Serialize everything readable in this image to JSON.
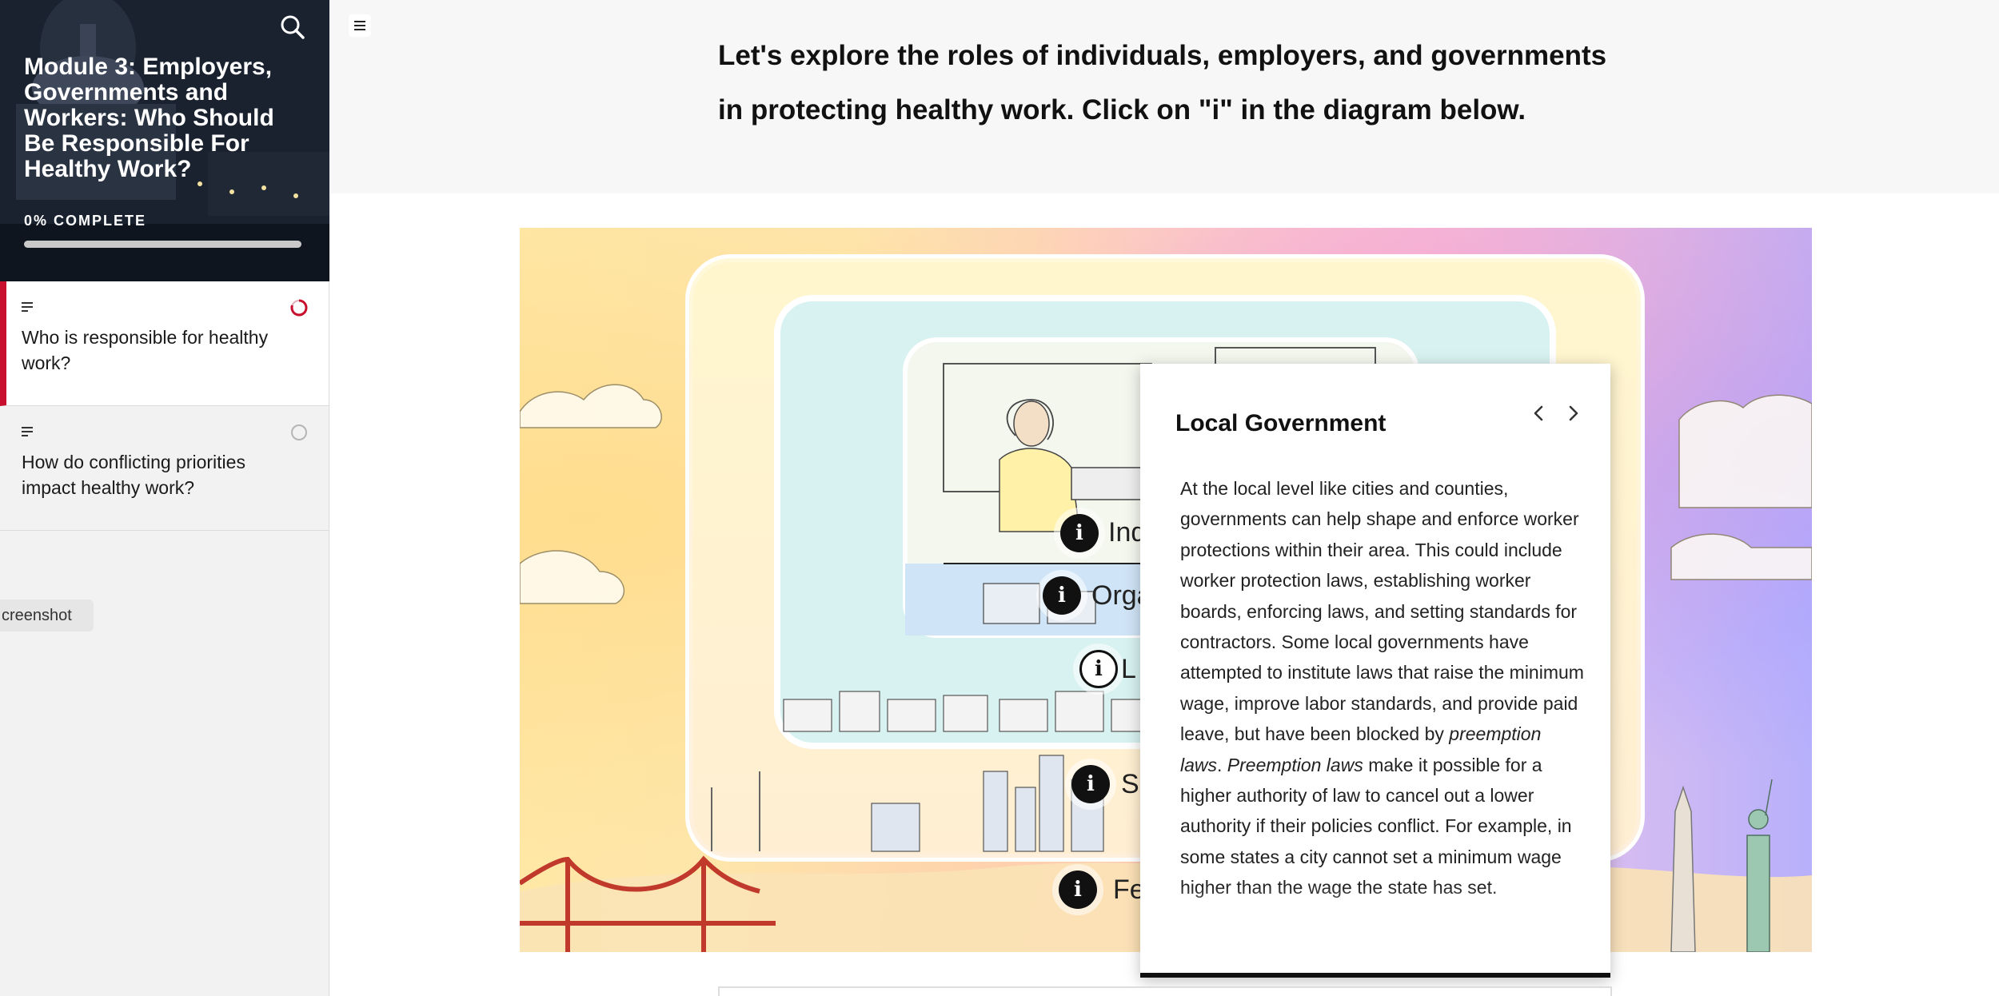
{
  "sidebar": {
    "course_title": "Module 3: Employers, Governments and Workers: Who Should Be Responsible For Healthy Work?",
    "progress_label": "0% COMPLETE",
    "progress_fraction": 0.0,
    "search_icon": "search-icon",
    "lessons": [
      {
        "title": "Who is responsible for healthy work?",
        "status": "in-progress",
        "active": true
      },
      {
        "title": "How do conflicting priorities impact healthy work?",
        "status": "not-started",
        "active": false
      }
    ],
    "screenshot_tag": "creenshot"
  },
  "main": {
    "menu_icon": "hamburger-menu-icon",
    "intro_text": "Let's explore the roles of individuals, employers, and governments in protecting healthy work. Click on \"i\"  in the diagram below.",
    "diagram": {
      "markers": [
        {
          "icon": "i",
          "label": "Ind"
        },
        {
          "icon": "i",
          "label": "Orga"
        },
        {
          "icon": "i",
          "label": "L"
        },
        {
          "icon": "i",
          "label": "S"
        },
        {
          "icon": "i",
          "label": "Fe"
        }
      ]
    },
    "popup": {
      "title": "Local Government",
      "prev_icon": "chevron-left-icon",
      "next_icon": "chevron-right-icon",
      "body_part1": "At the local level like cities and counties, governments can help shape and enforce worker protections within their area. This could include worker protection laws, establishing worker boards, enforcing laws, and setting standards for contractors. Some local governments have attempted to institute laws that raise the minimum wage, improve labor standards, and provide paid leave, but have been blocked by ",
      "body_em1": "preemption laws",
      "body_part2": ". ",
      "body_em2": "Preemption laws",
      "body_part3": " make it possible for a higher authority of law to cancel out a lower authority if their policies conflict. For example, in some states a city cannot set a minimum wage higher than the wage the state has set."
    }
  },
  "colors": {
    "accent": "#c8102e",
    "sidebar_header_bg": "#1b2432",
    "sidebar_bg": "#f2f2f2"
  }
}
